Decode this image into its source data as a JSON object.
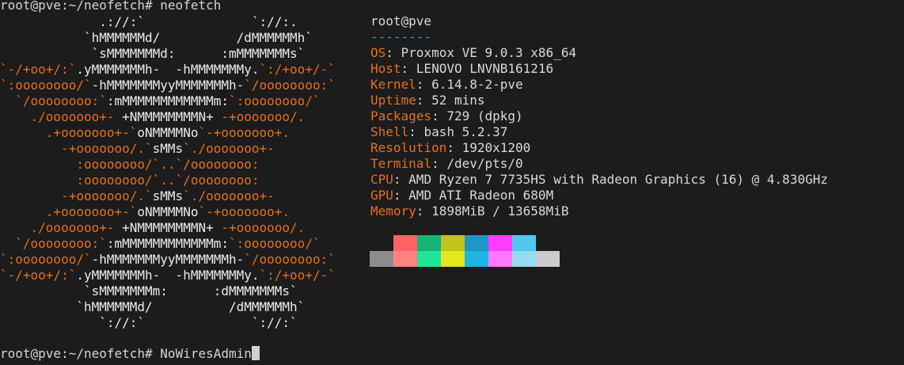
{
  "terminal": {
    "command_line": "root@pve:~/neofetch# neofetch",
    "prompt": "root@pve:~/neofetch# ",
    "current_input": "NoWiresAdmin"
  },
  "logo": {
    "lines": [
      [
        {
          "t": "             .://:`              `://:.",
          "c": "w"
        }
      ],
      [
        {
          "t": "           `hMMMMMMd/          /dMMMMMMh`",
          "c": "w"
        }
      ],
      [
        {
          "t": "            `sMMMMMMMd:      :mMMMMMMMs`",
          "c": "w"
        }
      ],
      [
        {
          "t": "`-/+oo+/:`",
          "c": "o"
        },
        {
          "t": ".yMMMMMMMh-  -hMMMMMMMy.",
          "c": "w"
        },
        {
          "t": "`:/+oo+/-`",
          "c": "o"
        }
      ],
      [
        {
          "t": "`:oooooooo/`",
          "c": "o"
        },
        {
          "t": "-hMMMMMMMyyMMMMMMMh-",
          "c": "w"
        },
        {
          "t": "`/oooooooo:`",
          "c": "o"
        }
      ],
      [
        {
          "t": "  `/oooooooo:`",
          "c": "o"
        },
        {
          "t": ":mMMMMMMMMMMMMm:",
          "c": "w"
        },
        {
          "t": "`:oooooooo/`",
          "c": "o"
        }
      ],
      [
        {
          "t": "    ./ooooooo+- ",
          "c": "o"
        },
        {
          "t": "+NMMMMMMMMN+",
          "c": "w"
        },
        {
          "t": " -+ooooooo/.",
          "c": "o"
        }
      ],
      [
        {
          "t": "      .+ooooooo+-`",
          "c": "o"
        },
        {
          "t": "oNMMMMNo",
          "c": "w"
        },
        {
          "t": "`-+ooooooo+.",
          "c": "o"
        }
      ],
      [
        {
          "t": "        -+ooooooo/.`",
          "c": "o"
        },
        {
          "t": "sMMs",
          "c": "w"
        },
        {
          "t": "`./ooooooo+-",
          "c": "o"
        }
      ],
      [
        {
          "t": "          :oooooooo/`..`/oooooooo:",
          "c": "o"
        }
      ],
      [
        {
          "t": "          :oooooooo/`..`/oooooooo:",
          "c": "o"
        }
      ],
      [
        {
          "t": "        -+ooooooo/.`",
          "c": "o"
        },
        {
          "t": "sMMs",
          "c": "w"
        },
        {
          "t": "`./ooooooo+-",
          "c": "o"
        }
      ],
      [
        {
          "t": "      .+ooooooo+-`",
          "c": "o"
        },
        {
          "t": "oNMMMMNo",
          "c": "w"
        },
        {
          "t": "`-+ooooooo+.",
          "c": "o"
        }
      ],
      [
        {
          "t": "    ./ooooooo+- ",
          "c": "o"
        },
        {
          "t": "+NMMMMMMMMN+",
          "c": "w"
        },
        {
          "t": " -+ooooooo/.",
          "c": "o"
        }
      ],
      [
        {
          "t": "  `/oooooooo:`",
          "c": "o"
        },
        {
          "t": ":mMMMMMMMMMMMMm:",
          "c": "w"
        },
        {
          "t": "`:oooooooo/`",
          "c": "o"
        }
      ],
      [
        {
          "t": "`:oooooooo/`",
          "c": "o"
        },
        {
          "t": "-hMMMMMMMyyMMMMMMMh-",
          "c": "w"
        },
        {
          "t": "`/oooooooo:`",
          "c": "o"
        }
      ],
      [
        {
          "t": "`-/+oo+/:`",
          "c": "o"
        },
        {
          "t": ".yMMMMMMMh-  -hMMMMMMMy.",
          "c": "w"
        },
        {
          "t": "`:/+oo+/-`",
          "c": "o"
        }
      ],
      [
        {
          "t": "           `sMMMMMMMm:      :dMMMMMMMs`",
          "c": "w"
        }
      ],
      [
        {
          "t": "          `hMMMMMMd/          /dMMMMMMh`",
          "c": "w"
        }
      ],
      [
        {
          "t": "             `://:`              `://:`",
          "c": "w"
        }
      ]
    ]
  },
  "info": {
    "header": "root@pve",
    "separator": "--------",
    "rows": [
      {
        "key": "OS",
        "value": "Proxmox VE 9.0.3 x86_64"
      },
      {
        "key": "Host",
        "value": "LENOVO LNVNB161216"
      },
      {
        "key": "Kernel",
        "value": "6.14.8-2-pve"
      },
      {
        "key": "Uptime",
        "value": "52 mins"
      },
      {
        "key": "Packages",
        "value": "729 (dpkg)"
      },
      {
        "key": "Shell",
        "value": "bash 5.2.37"
      },
      {
        "key": "Resolution",
        "value": "1920x1200"
      },
      {
        "key": "Terminal",
        "value": "/dev/pts/0"
      },
      {
        "key": "CPU",
        "value": "AMD Ryzen 7 7735HS with Radeon Graphics (16) @ 4.830GHz"
      },
      {
        "key": "GPU",
        "value": "AMD ATI Radeon 680M"
      },
      {
        "key": "Memory",
        "value": "1898MiB / 13658MiB"
      }
    ]
  },
  "colors": {
    "background": "#1c1c1c",
    "accent_orange": "#e5701e",
    "separator_blue": "#3a96dd",
    "palette_row1": [
      "#1c1c1c",
      "#ff6464",
      "#14b478",
      "#c3c31e",
      "#1e96c8",
      "#ff3cff",
      "#50c8f0",
      "#1c1c1c"
    ],
    "palette_row2": [
      "#8c8c8c",
      "#ff8282",
      "#1ee696",
      "#e6e61e",
      "#1eb4e6",
      "#ff78ff",
      "#96dcf0",
      "#cccccc"
    ]
  }
}
